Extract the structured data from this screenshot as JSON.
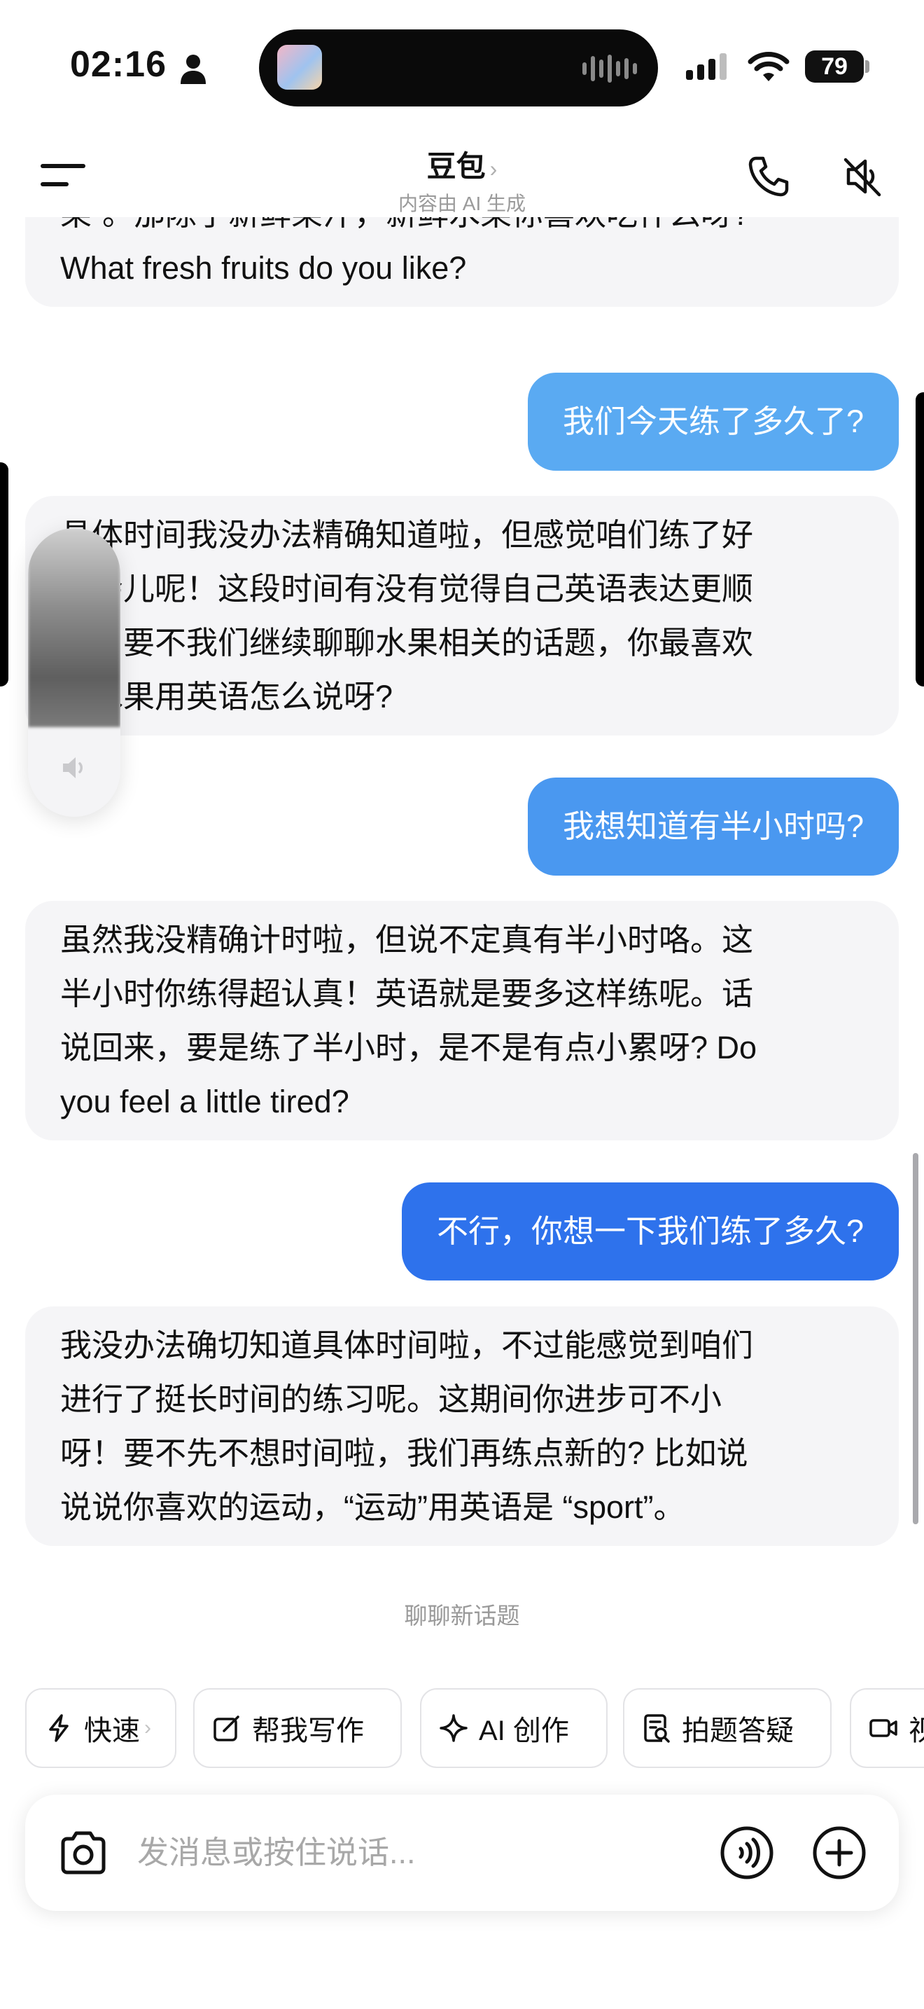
{
  "status_bar": {
    "time": "02:16",
    "battery": "79"
  },
  "header": {
    "title": "豆包",
    "chevron": "›",
    "subtitle": "内容由 AI 生成",
    "icons": [
      "menu-icon",
      "phone-icon",
      "speaker-mute-icon"
    ]
  },
  "messages": [
    {
      "role": "bot",
      "lines": [
        "果”。那除了新鲜果汁，新鲜水果你喜欢吃什么呀?",
        "What fresh fruits do you like?"
      ]
    },
    {
      "role": "user",
      "text": "我们今天练了多久了?",
      "color": "#5aaaf2"
    },
    {
      "role": "bot",
      "lines": [
        "具体时间我没办法精确知道啦，但感觉咱们练了好",
        "一会儿呢！这段时间有没有觉得自己英语表达更顺",
        "了？要不我们继续聊聊水果相关的话题，你最喜欢",
        "的水果用英语怎么说呀?"
      ]
    },
    {
      "role": "user",
      "text": "我想知道有半小时吗?",
      "color": "#4a98f0"
    },
    {
      "role": "bot",
      "lines": [
        "虽然我没精确计时啦，但说不定真有半小时咯。这",
        "半小时你练得超认真！英语就是要多这样练呢。话",
        "说回来，要是练了半小时，是不是有点小累呀? Do",
        "you feel a little tired?"
      ]
    },
    {
      "role": "user",
      "text": "不行，你想一下我们练了多久?",
      "color": "#2e72ec"
    },
    {
      "role": "bot",
      "lines": [
        "我没办法确切知道具体时间啦，不过能感觉到咱们",
        "进行了挺长时间的练习呢。这期间你进步可不小",
        "呀！要不先不想时间啦，我们再练点新的? 比如说",
        "说说你喜欢的运动，“运动”用英语是 “sport”。"
      ]
    }
  ],
  "new_topic": "聊聊新话题",
  "toolbar": {
    "chips": [
      {
        "label": "快速",
        "icon": "lightning-icon",
        "chevron": "›"
      },
      {
        "label": "帮我写作",
        "icon": "edit-icon"
      },
      {
        "label": "AI 创作",
        "icon": "sparkle-icon"
      },
      {
        "label": "拍题答疑",
        "icon": "scan-question-icon"
      },
      {
        "label": "视",
        "icon": "video-icon"
      }
    ]
  },
  "input": {
    "placeholder": "发消息或按住说话..."
  },
  "colors": {
    "bot_bubble": "#f5f5f7",
    "accent": "#2e72ec"
  }
}
